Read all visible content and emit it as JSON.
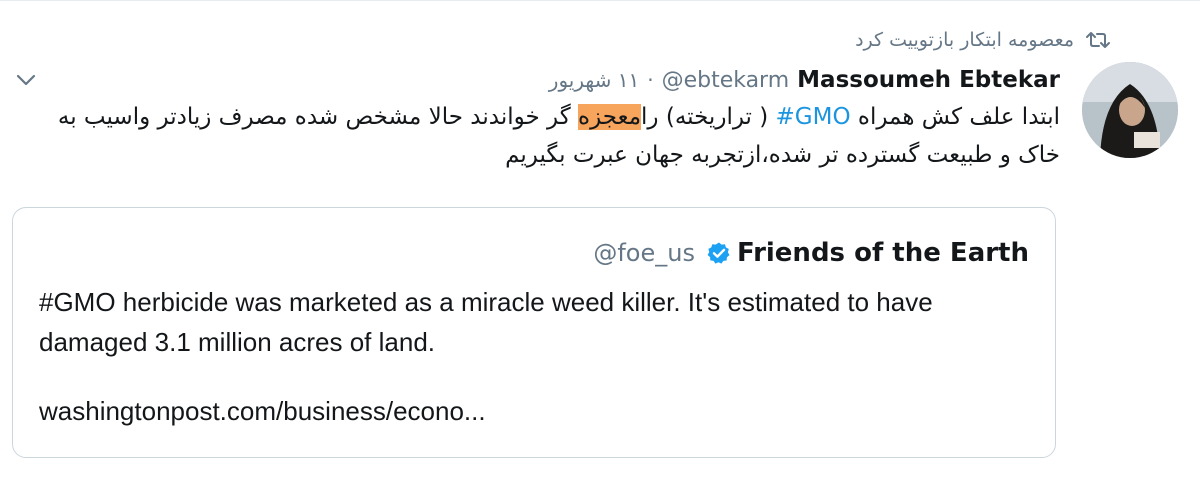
{
  "retweet": {
    "label": "معصومه ابتکار بازتوییت کرد",
    "icon": "retweet-icon"
  },
  "tweet": {
    "author_name": "Massoumeh Ebtekar",
    "author_handle": "@ebtekarm",
    "separator": "·",
    "date": "۱۱ شهریور",
    "text_part1": "ابتدا علف کش همراه ",
    "hashtag": "#GMO",
    "text_part2": " ( تراریخته) را",
    "highlighted_word": "معجزه",
    "text_part3": " گر خواندند حالا مشخص شده مصرف زیادتر واسیب به خاک و طبیعت گسترده تر شده،ازتجربه جهان عبرت بگیریم",
    "highlight_color": "#f7a45c",
    "hashtag_color": "#1b95e0"
  },
  "quoted": {
    "name": "Friends of the Earth",
    "handle": "@foe_us",
    "verified_icon": "verified-badge-icon",
    "text": "#GMO herbicide was marketed as a miracle weed killer. It's estimated to have damaged 3.1 million acres of land.",
    "link": "washingtonpost.com/business/econo..."
  },
  "colors": {
    "secondary_text": "#657786",
    "verified_blue": "#1da1f2",
    "border": "#ccd6dd"
  }
}
